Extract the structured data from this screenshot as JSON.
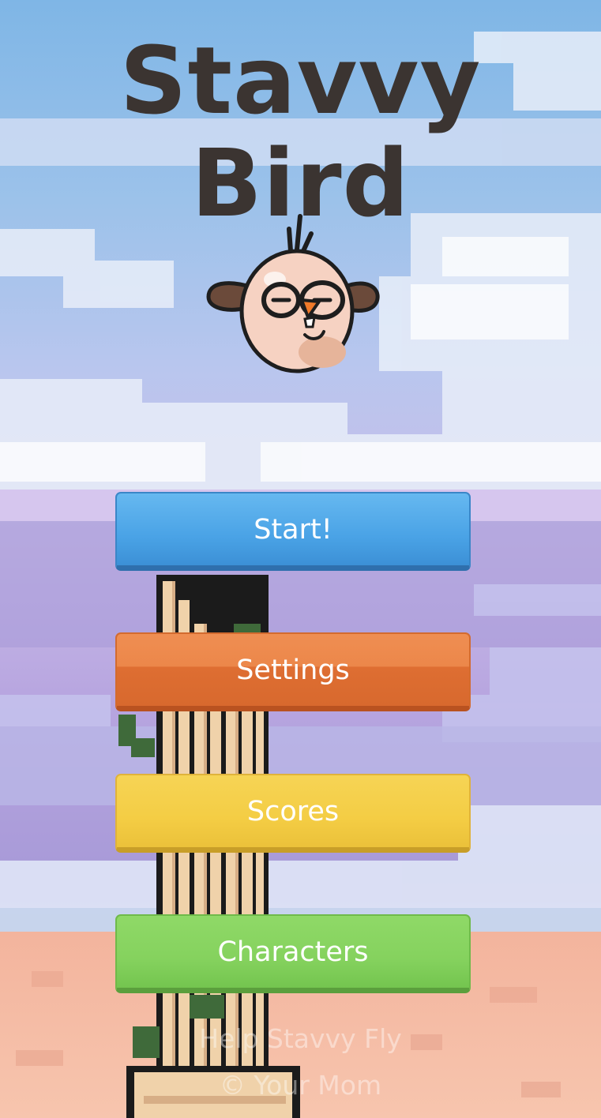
{
  "game": {
    "title": "Stavvy Bird"
  },
  "menu": {
    "start_label": "Start!",
    "settings_label": "Settings",
    "scores_label": "Scores",
    "characters_label": "Characters"
  },
  "footer": {
    "tagline": "Help Stavvy Fly",
    "copyright": "© Your Mom"
  },
  "colors": {
    "start": "#4aa3e6",
    "settings": "#ec874a",
    "scores": "#f4cd44",
    "characters": "#85d25e",
    "title": "#3b3431"
  },
  "icons": {
    "character": "stavvy-bird-character"
  }
}
